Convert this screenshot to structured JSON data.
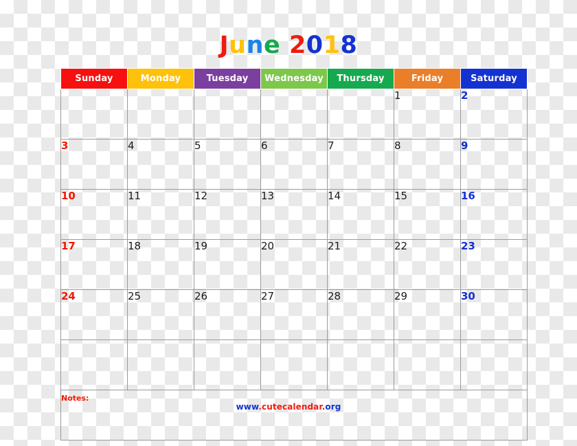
{
  "title": {
    "text": "June 2018",
    "month": "June",
    "year": "2018",
    "letters": [
      {
        "char": "J",
        "color": "#ee1c10"
      },
      {
        "char": "u",
        "color": "#ffc20a"
      },
      {
        "char": "n",
        "color": "#1a83e8"
      },
      {
        "char": "e",
        "color": "#16a94f"
      },
      {
        "char": " ",
        "color": "#000000"
      },
      {
        "char": "2",
        "color": "#ee1c10"
      },
      {
        "char": "0",
        "color": "#1432d2"
      },
      {
        "char": "1",
        "color": "#ffc20a"
      },
      {
        "char": "8",
        "color": "#1432d2"
      }
    ]
  },
  "weekdays": [
    {
      "label": "Sunday",
      "bg": "#f80f0f",
      "kind": "sun"
    },
    {
      "label": "Monday",
      "bg": "#ffc20a",
      "kind": "weekday"
    },
    {
      "label": "Tuesday",
      "bg": "#7b3fa0",
      "kind": "weekday"
    },
    {
      "label": "Wednesday",
      "bg": "#7dc74a",
      "kind": "weekday"
    },
    {
      "label": "Thursday",
      "bg": "#16a94f",
      "kind": "weekday"
    },
    {
      "label": "Friday",
      "bg": "#eb7e28",
      "kind": "weekday"
    },
    {
      "label": "Saturday",
      "bg": "#1432d2",
      "kind": "sat"
    }
  ],
  "weeks": [
    [
      "",
      "",
      "",
      "",
      "",
      "1",
      "2"
    ],
    [
      "3",
      "4",
      "5",
      "6",
      "7",
      "8",
      "9"
    ],
    [
      "10",
      "11",
      "12",
      "13",
      "14",
      "15",
      "16"
    ],
    [
      "17",
      "18",
      "19",
      "20",
      "21",
      "22",
      "23"
    ],
    [
      "24",
      "25",
      "26",
      "27",
      "28",
      "29",
      "30"
    ],
    [
      "",
      "",
      "",
      "",
      "",
      "",
      ""
    ]
  ],
  "notes": {
    "label": "Notes:"
  },
  "footer": {
    "url": "www.cutecalendar.org",
    "parts": [
      {
        "text": "www",
        "color": "#1432d2"
      },
      {
        "text": ".",
        "color": "#ee1c10"
      },
      {
        "text": "cutecalendar",
        "color": "#ee1c10"
      },
      {
        "text": ".",
        "color": "#ee1c10"
      },
      {
        "text": "org",
        "color": "#1432d2"
      }
    ]
  },
  "colors": {
    "sunday_date": "#f01800",
    "saturday_date": "#1432d2",
    "weekday_date": "#1a1a1a",
    "grid_border": "#9a9a9a",
    "notes_label": "#f01800"
  }
}
